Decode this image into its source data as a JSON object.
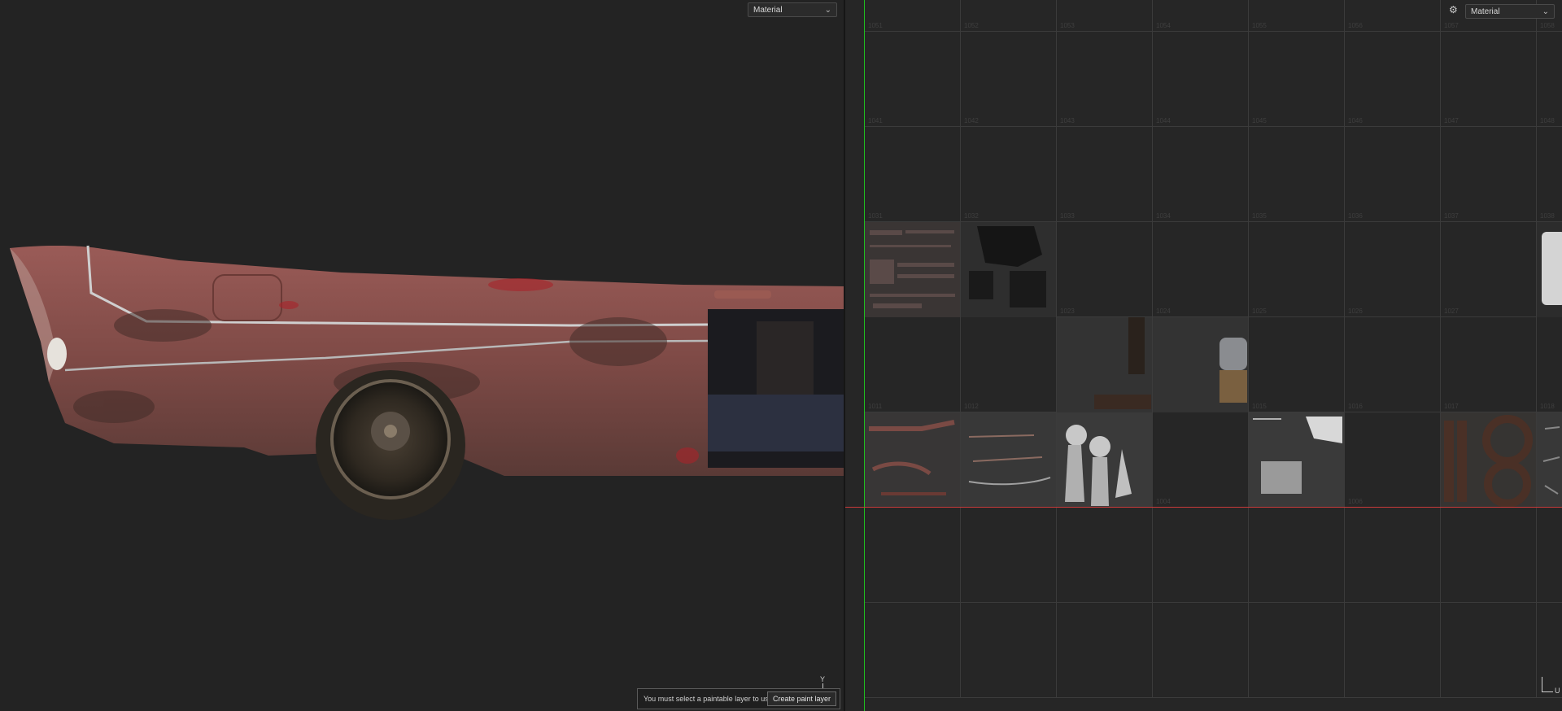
{
  "viewport3d": {
    "channel_dropdown": {
      "selected": "Material"
    },
    "axis_label": "Y"
  },
  "viewport2d": {
    "channel_dropdown": {
      "selected": "Material"
    },
    "axis_label": "U",
    "udim_rows": [
      [
        "1051",
        "1052",
        "1053",
        "1054",
        "1055",
        "1056",
        "1057",
        "1058"
      ],
      [
        "1041",
        "1042",
        "1043",
        "1044",
        "1045",
        "1046",
        "1047",
        "1048"
      ],
      [
        "1031",
        "1032",
        "1033",
        "1034",
        "1035",
        "1036",
        "1037",
        "1038"
      ],
      [
        "1021",
        "1022",
        "1023",
        "1024",
        "1025",
        "1026",
        "1027",
        "1028"
      ],
      [
        "1011",
        "1012",
        "1013",
        "1014",
        "1015",
        "1016",
        "1017",
        "1018"
      ],
      [
        "1001",
        "1002",
        "1003",
        "1004",
        "1005",
        "1006",
        "1007",
        "1008"
      ]
    ]
  },
  "notice": {
    "message": "You must select a paintable layer to use this tool",
    "button_label": "Create paint layer"
  },
  "colors": {
    "background": "#232323",
    "car_paint": "#8a4a48",
    "u_axis_line": "#1fc01f",
    "v_axis_line": "#c83a3a"
  }
}
